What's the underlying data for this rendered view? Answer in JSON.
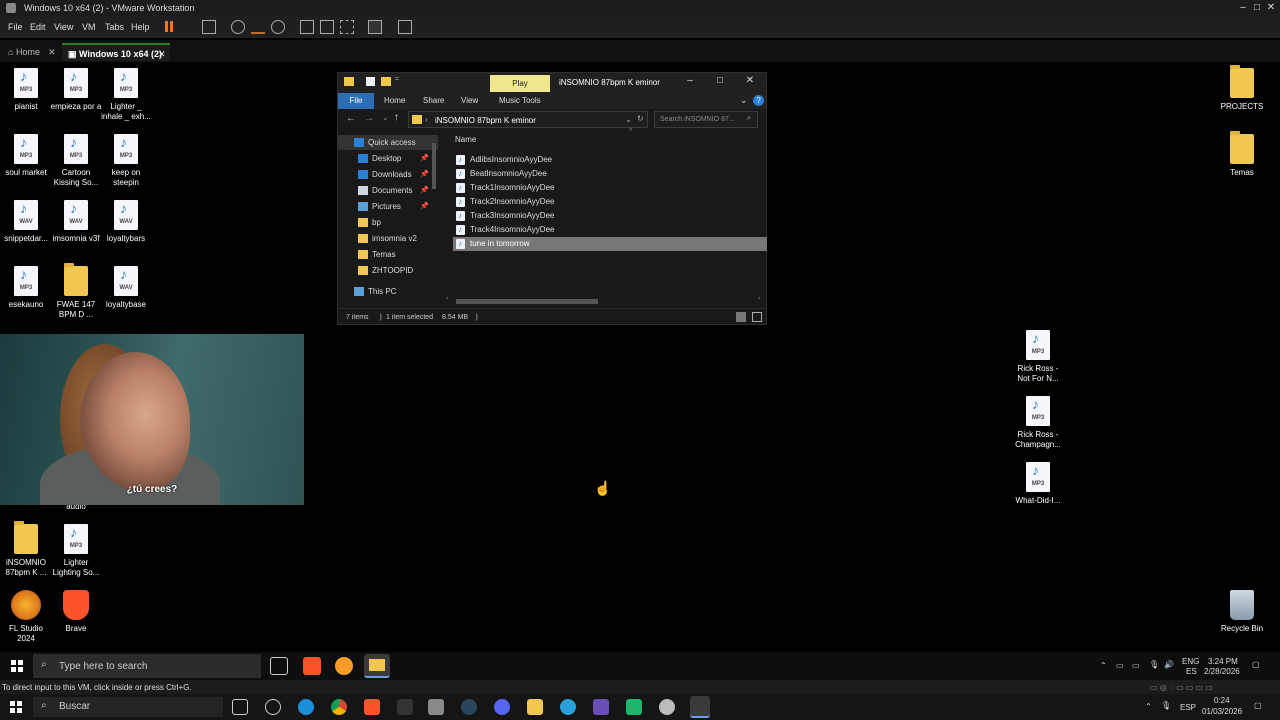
{
  "vm": {
    "title": "Windows 10 x64 (2) - VMware Workstation",
    "menu": [
      "File",
      "Edit",
      "View",
      "VM",
      "Tabs",
      "Help"
    ],
    "tabs": [
      {
        "label": "Home"
      },
      {
        "label": "Windows 10 x64 (2)"
      }
    ],
    "status_text": "To direct input to this VM, click inside or press Ctrl+G."
  },
  "desktop_left": [
    {
      "label": "pianist",
      "type": "mp3"
    },
    {
      "label": "empieza por a",
      "type": "mp3"
    },
    {
      "label": "Lighter _ inhale _ exh...",
      "type": "mp3"
    },
    {
      "label": "soul market",
      "type": "mp3"
    },
    {
      "label": "Cartoon Kissing So...",
      "type": "mp3"
    },
    {
      "label": "keep on steepin",
      "type": "mp3"
    },
    {
      "label": "snippetdar...",
      "type": "wav"
    },
    {
      "label": "imsomnia v3f",
      "type": "wav"
    },
    {
      "label": "loyaltybars",
      "type": "wav"
    },
    {
      "label": "esekauno",
      "type": "mp3"
    },
    {
      "label": "FWAE 147 BPM D ...",
      "type": "folder"
    },
    {
      "label": "loyaltybase",
      "type": "wav"
    },
    {
      "label": "audio",
      "type": "text"
    },
    {
      "label": "iNSOMNIO 87bpm K ...",
      "type": "folder"
    },
    {
      "label": "Lighter Lighting So...",
      "type": "mp3"
    },
    {
      "label": "FL Studio 2024",
      "type": "app-fl"
    },
    {
      "label": "Brave",
      "type": "app-brave"
    }
  ],
  "desktop_right": [
    {
      "label": "PROJECTS",
      "type": "folder"
    },
    {
      "label": "Temas",
      "type": "folder"
    },
    {
      "label": "Rick Ross - Not For N...",
      "type": "mp3"
    },
    {
      "label": "Rick Ross - Champagn...",
      "type": "mp3"
    },
    {
      "label": "What-Did-I...",
      "type": "mp3"
    },
    {
      "label": "Recycle Bin",
      "type": "recycle"
    }
  ],
  "video": {
    "subtitle": "¿tú crees?"
  },
  "explorer": {
    "play_tab": "Play",
    "window_title": "iNSOMNIO 87bpm K eminor",
    "ribbon": [
      "File",
      "Home",
      "Share",
      "View",
      "Music Tools"
    ],
    "address": "iNSOMNIO 87bpm K eminor",
    "search_placeholder": "Search iNSOMNIO 87...",
    "nav": [
      {
        "label": "Quick access",
        "icon": "star-icon",
        "pinned": false
      },
      {
        "label": "Desktop",
        "icon": "desktop-icon",
        "pinned": true
      },
      {
        "label": "Downloads",
        "icon": "download-icon",
        "pinned": true
      },
      {
        "label": "Documents",
        "icon": "document-icon",
        "pinned": true
      },
      {
        "label": "Pictures",
        "icon": "picture-icon",
        "pinned": true
      },
      {
        "label": "bp",
        "icon": "folder-icon",
        "pinned": false
      },
      {
        "label": "imsomnia v2",
        "icon": "folder-icon",
        "pinned": false
      },
      {
        "label": "Temas",
        "icon": "folder-icon",
        "pinned": false
      },
      {
        "label": "ZHTOOPID",
        "icon": "folder-icon",
        "pinned": false
      },
      {
        "label": "This PC",
        "icon": "pc-icon",
        "pinned": false
      }
    ],
    "column_name": "Name",
    "files": [
      "AdlibsInsomnioAyyDee",
      "BeatInsomnioAyyDee",
      "Track1InsomnioAyyDee",
      "Track2InsomnioAyyDee",
      "Track3InsomnioAyyDee",
      "Track4InsomnioAyyDee",
      "tune in tomorrow"
    ],
    "selected_index": 6,
    "status": {
      "items": "7 items",
      "selected": "1 item selected",
      "size": "8.54 MB"
    }
  },
  "guest_taskbar": {
    "search": "Type here to search",
    "lang": "ENG",
    "lang2": "ES",
    "time": "3:24 PM",
    "date": "2/28/2026"
  },
  "host_taskbar": {
    "search": "Buscar",
    "lang": "ESP",
    "time": "0:24",
    "date": "01/03/2026"
  },
  "colors": {
    "accent": "#2a6fb6",
    "play_tab": "#f0e68c",
    "selection": "#777777"
  }
}
